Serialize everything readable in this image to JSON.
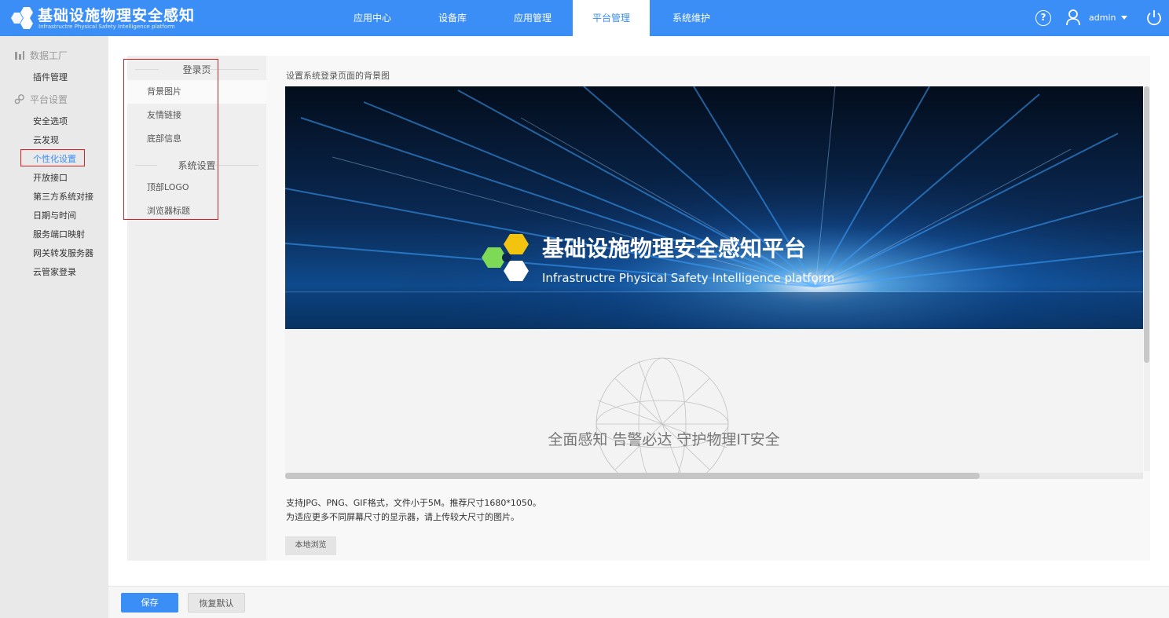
{
  "header": {
    "title": "基础设施物理安全感知",
    "subtitle": "Infrastructre Physical Safety Intelligence platform",
    "nav": [
      "应用中心",
      "设备库",
      "应用管理",
      "平台管理",
      "系统维护"
    ],
    "active_nav": "平台管理",
    "user": "admin",
    "accent_color": "#3a8ef6"
  },
  "sidebar": {
    "groups": [
      {
        "label": "数据工厂",
        "icon": "chart-icon",
        "items": [
          "插件管理"
        ]
      },
      {
        "label": "平台设置",
        "icon": "gear-icon",
        "items": [
          "安全选项",
          "云发现",
          "个性化设置",
          "开放接口",
          "第三方系统对接",
          "日期与时间",
          "服务端口映射",
          "网关转发服务器",
          "云管家登录"
        ]
      }
    ],
    "active_item": "个性化设置"
  },
  "submenu": {
    "section1": "登录页",
    "items1": [
      "背景图片",
      "友情链接",
      "底部信息"
    ],
    "section2": "系统设置",
    "items2": [
      "顶部LOGO",
      "浏览器标题"
    ],
    "active_item": "背景图片"
  },
  "panel": {
    "title": "设置系统登录页面的背景图",
    "preview": {
      "banner_title": "基础设施物理安全感知平台",
      "banner_subtitle": "Infrastructre Physical Safety Intelligence platform",
      "slogan": "全面感知 告警必达 守护物理IT安全"
    },
    "hint1": "支持JPG、PNG、GIF格式，文件小于5M。推荐尺寸1680*1050。",
    "hint2": "为适应更多不同屏幕尺寸的显示器，请上传较大尺寸的图片。",
    "browse_label": "本地浏览"
  },
  "footer": {
    "save_label": "保存",
    "reset_label": "恢复默认"
  }
}
